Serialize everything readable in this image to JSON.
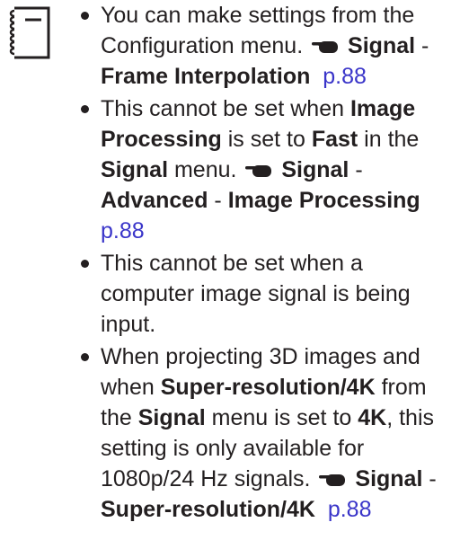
{
  "icons": {
    "note": "notepad-icon",
    "reference": "pointing-hand-icon"
  },
  "notes": [
    {
      "text1": "You can make settings from the Configuration menu.",
      "ref_parts": [
        "Signal",
        " - ",
        "Frame Interpolation"
      ],
      "page": "p.88"
    },
    {
      "text1": "This cannot be set when ",
      "b1": "Image Processing",
      "text2": " is set to ",
      "b2": "Fast",
      "text3": " in the ",
      "b3": "Signal",
      "text4": " menu.",
      "ref_parts": [
        "Signal",
        " - ",
        "Advanced",
        " - ",
        "Image Processing"
      ],
      "page": "p.88"
    },
    {
      "text1": "This cannot be set when a computer image signal is being input."
    },
    {
      "text1": "When projecting 3D images and when ",
      "b1": "Super-resolution/4K",
      "text2": " from the ",
      "b2": "Signal",
      "text3": " menu is set to ",
      "b3": "4K",
      "text4": ", this setting is only available for 1080p/24 Hz signals.",
      "ref_parts": [
        "Signal",
        " - ",
        "Super-resolution/4K"
      ],
      "page": "p.88"
    }
  ]
}
